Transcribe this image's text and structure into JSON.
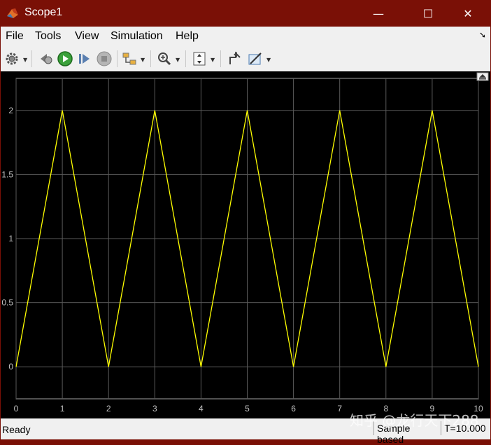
{
  "window": {
    "title": "Scope1",
    "controls": {
      "minimize": "—",
      "maximize": "☐",
      "close": "✕"
    }
  },
  "menu": {
    "items": [
      "File",
      "Tools",
      "View",
      "Simulation",
      "Help"
    ]
  },
  "toolbar": {
    "buttons": [
      "settings-icon",
      "step-back-icon",
      "run-icon",
      "step-forward-icon",
      "stop-icon",
      "highlight-block-icon",
      "zoom-in-icon",
      "autoscale-icon",
      "restore-view-icon",
      "measurements-icon"
    ]
  },
  "colors": {
    "titlebar": "#7a1006",
    "plot_background": "#000000",
    "axes_background": "#000000",
    "grid": "#5a5a5a",
    "line": "#ffff00",
    "tick_text": "#c0c0c0"
  },
  "chart_data": {
    "type": "line",
    "title": "",
    "xlabel": "",
    "ylabel": "",
    "xlim": [
      0,
      10
    ],
    "ylim": [
      -0.25,
      2.25
    ],
    "xticks": [
      0,
      1,
      2,
      3,
      4,
      5,
      6,
      7,
      8,
      9,
      10
    ],
    "xtick_labels": [
      "0",
      "1",
      "2",
      "3",
      "4",
      "5",
      "6",
      "7",
      "8",
      "9",
      "10"
    ],
    "yticks": [
      0,
      0.5,
      1,
      1.5,
      2
    ],
    "ytick_labels": [
      "0",
      "0.5",
      "1",
      "1.5",
      "2"
    ],
    "grid": true,
    "series": [
      {
        "x": [
          0,
          1,
          2,
          3,
          4,
          5,
          6,
          7,
          8,
          9,
          10
        ],
        "y": [
          0,
          2,
          0,
          2,
          0,
          2,
          0,
          2,
          0,
          2,
          0
        ]
      }
    ]
  },
  "status": {
    "ready": "Ready",
    "sample_mode": "Sample based",
    "time": "T=10.000"
  },
  "watermark": "知乎 @龙行天下288"
}
